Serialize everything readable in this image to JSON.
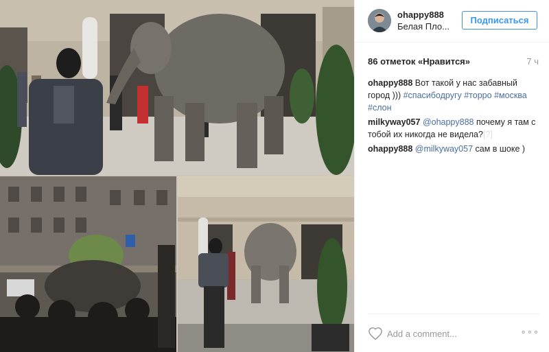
{
  "header": {
    "username": "ohappy888",
    "location": "Белая Пло...",
    "follow_label": "Подписаться"
  },
  "meta": {
    "likes": "86 отметок «Нравится»",
    "time": "7 ч"
  },
  "comments": [
    {
      "user": "ohappy888",
      "text": "Вот такой у нас забавный город ))) ",
      "tags": [
        "#спасибодругу",
        "#торро",
        "#москва",
        "#слон"
      ]
    },
    {
      "user": "milkyway057",
      "mention": "@ohappy888",
      "text": " почему я там с тобой их никогда не видела?",
      "hidden": "[?]"
    },
    {
      "user": "ohappy888",
      "mention": "@milkyway057",
      "text": " сам в шоке )"
    }
  ],
  "footer": {
    "comment_placeholder": "Add a comment...",
    "more": "∘∘∘"
  },
  "icons": {
    "like": "heart-icon",
    "more": "more-options-icon"
  },
  "colors": {
    "link": "#4a6da0",
    "follow": "#3897f0",
    "muted": "#999999"
  }
}
